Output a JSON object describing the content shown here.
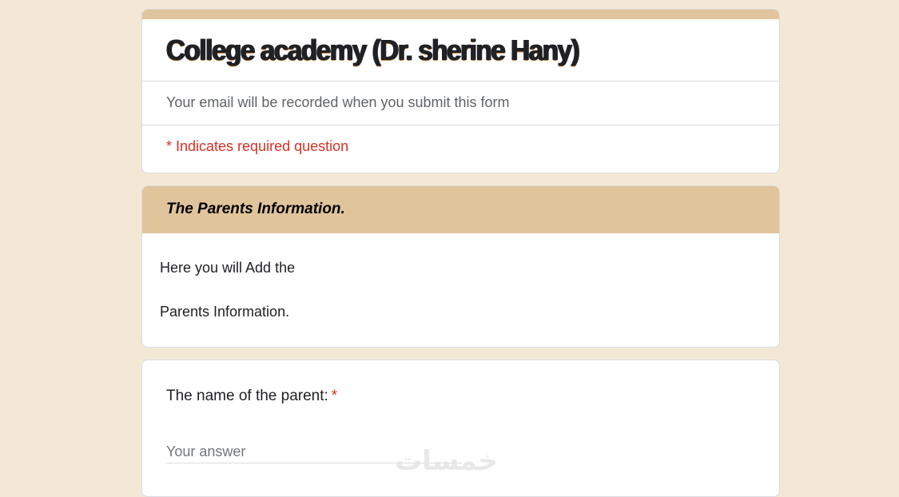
{
  "form": {
    "title": "College academy (Dr. sherine Hany)",
    "email_note": "Your email will be recorded when you submit this form",
    "required_note": "* Indicates required question"
  },
  "section": {
    "title": "The Parents Information.",
    "description_line1": "Here you will Add the",
    "description_line2": "Parents Information."
  },
  "question": {
    "label": "The name of the parent:",
    "required_marker": "*",
    "placeholder": "Your answer",
    "value": ""
  },
  "watermark": {
    "text": "خمسات"
  },
  "colors": {
    "page_background": "#f3e8d6",
    "accent": "#e0c49b",
    "required": "#d93025"
  }
}
